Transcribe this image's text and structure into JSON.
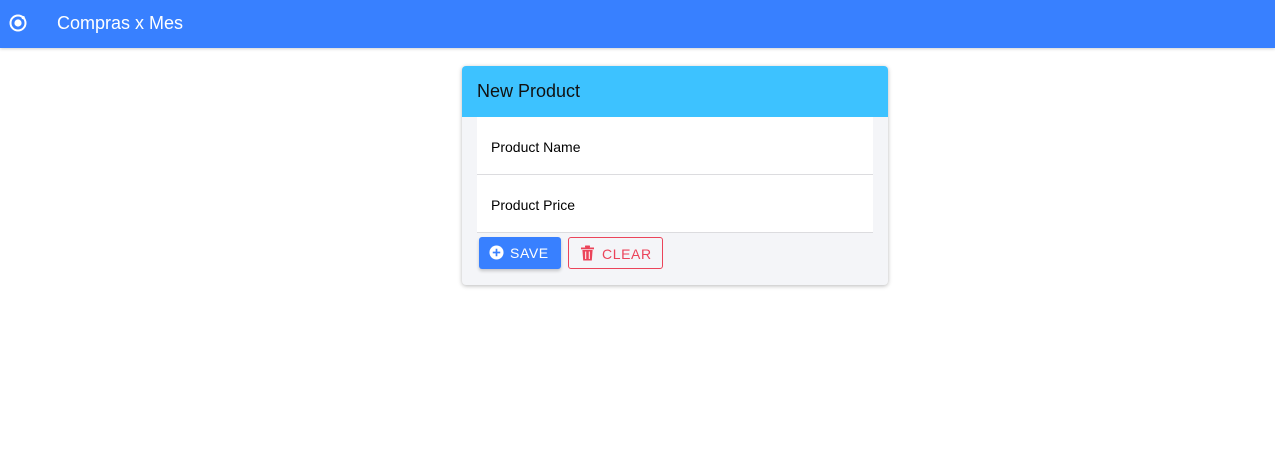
{
  "toolbar": {
    "title": "Compras x Mes",
    "logo_icon": "ionic-logo-icon",
    "background": "#3880ff"
  },
  "card": {
    "title": "New Product",
    "header_color": "#3dc2ff",
    "fields": {
      "name": {
        "placeholder": "Product Name",
        "value": ""
      },
      "price": {
        "placeholder": "Product Price",
        "value": ""
      }
    },
    "buttons": {
      "save": {
        "label": "SAVE",
        "icon": "add-circle-icon",
        "color": "#3880ff"
      },
      "clear": {
        "label": "CLEAR",
        "icon": "trash-icon",
        "color": "#eb445a"
      }
    }
  }
}
